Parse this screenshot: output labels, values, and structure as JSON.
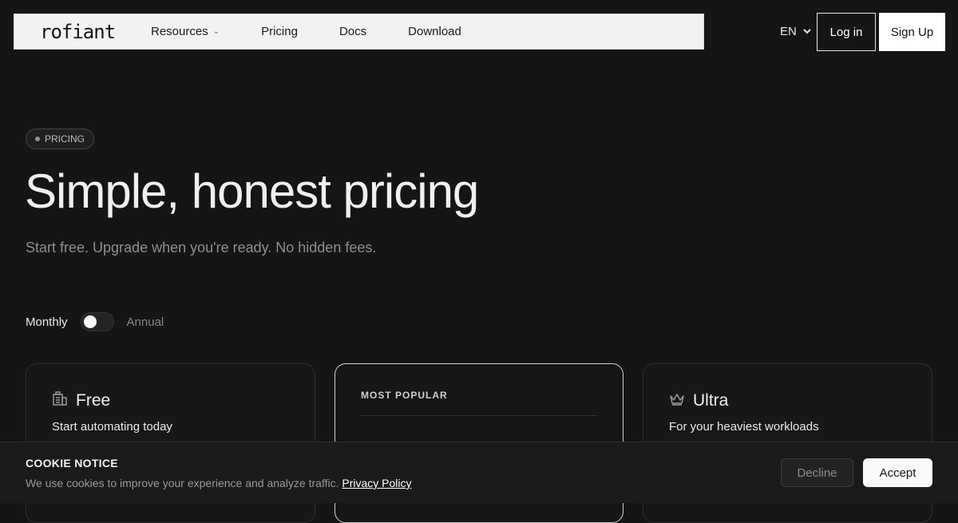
{
  "header": {
    "logo": "rofiant",
    "nav": [
      {
        "label": "Resources",
        "has_dropdown": true
      },
      {
        "label": "Pricing"
      },
      {
        "label": "Docs"
      },
      {
        "label": "Download"
      }
    ],
    "language": "EN",
    "login_label": "Log in",
    "signup_label": "Sign Up"
  },
  "hero": {
    "badge": "PRICING",
    "title": "Simple, honest pricing",
    "subtitle": "Start free. Upgrade when you're ready. No hidden fees."
  },
  "billing_toggle": {
    "monthly_label": "Monthly",
    "annual_label": "Annual",
    "selected": "Monthly"
  },
  "plans": [
    {
      "name": "Free",
      "icon": "building-icon",
      "tagline": "Start automating today"
    },
    {
      "popular_label": "MOST POPULAR"
    },
    {
      "name": "Ultra",
      "icon": "crown-icon",
      "tagline": "For your heaviest workloads"
    }
  ],
  "cookie": {
    "title": "COOKIE NOTICE",
    "text": "We use cookies to improve your experience and analyze traffic.",
    "link": "Privacy Policy",
    "decline_label": "Decline",
    "accept_label": "Accept"
  },
  "colors": {
    "background": "#151515",
    "nav_background": "#f2f2f2",
    "text": "#eaeaea",
    "muted_text": "#8f8f8f",
    "accent_button": "#fafafa"
  }
}
